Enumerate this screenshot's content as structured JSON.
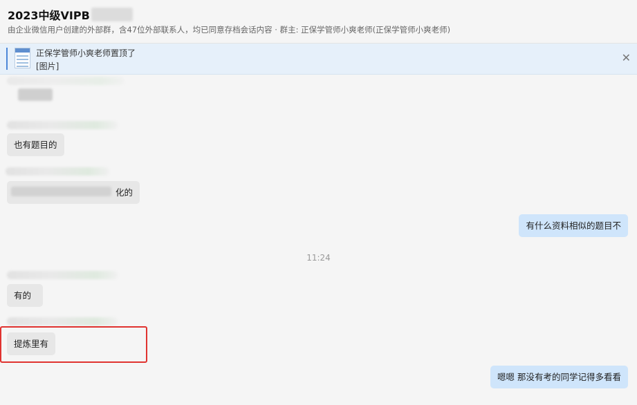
{
  "header": {
    "title": "2023中级VIPB",
    "subtitle": "由企业微信用户创建的外部群，含47位外部联系人，均已同意存档会话内容  · 群主: 正保学管师小爽老师(正保学管师小爽老师)"
  },
  "pinned": {
    "text": "正保学管师小爽老师置顶了",
    "sub": "[图片]",
    "close_icon": "close-icon"
  },
  "messages": [
    {
      "side": "left",
      "text": ""
    },
    {
      "side": "left",
      "text": "也有题目的"
    },
    {
      "side": "left",
      "text": "化的"
    },
    {
      "side": "right",
      "text": "有什么资料相似的题目不"
    },
    {
      "side": "left",
      "text": "有的"
    },
    {
      "side": "left",
      "text": "提炼里有"
    },
    {
      "side": "right",
      "text": "嗯嗯  那没有考的同学记得多看看"
    }
  ],
  "time_divider": "11:24",
  "colors": {
    "mine_bubble": "#cfe5fb",
    "other_bubble": "#e7e7e7",
    "highlight": "#e0322f"
  }
}
